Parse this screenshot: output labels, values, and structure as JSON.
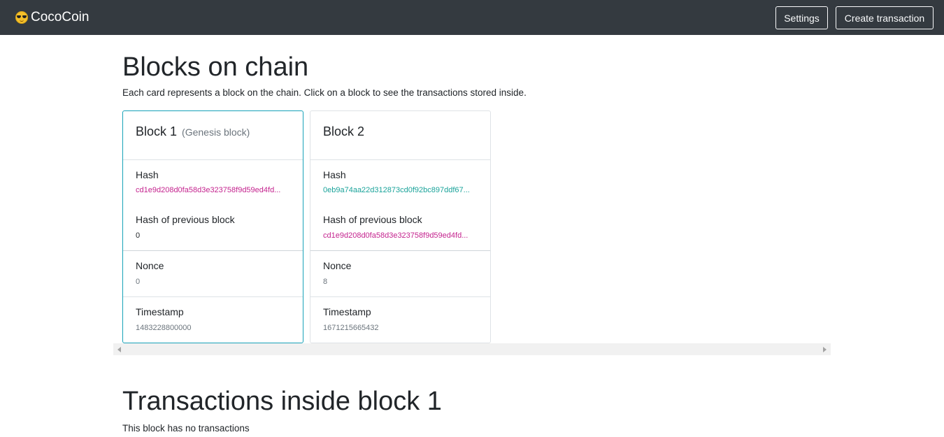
{
  "navbar": {
    "brand": "CocoCoin",
    "brand_icon": "sunglasses-face-icon",
    "settings_label": "Settings",
    "create_transaction_label": "Create transaction"
  },
  "blocks_section": {
    "title": "Blocks on chain",
    "description": "Each card represents a block on the chain. Click on a block to see the transactions stored inside."
  },
  "blocks": [
    {
      "title": "Block 1",
      "subtitle": "(Genesis block)",
      "hash_label": "Hash",
      "hash": "cd1e9d208d0fa58d3e323758f9d59ed4fd...",
      "prev_hash_label": "Hash of previous block",
      "prev_hash": "0",
      "nonce_label": "Nonce",
      "nonce": "0",
      "timestamp_label": "Timestamp",
      "timestamp": "1483228800000"
    },
    {
      "title": "Block 2",
      "subtitle": "",
      "hash_label": "Hash",
      "hash": "0eb9a74aa22d312873cd0f92bc897ddf67...",
      "prev_hash_label": "Hash of previous block",
      "prev_hash": "cd1e9d208d0fa58d3e323758f9d59ed4fd...",
      "nonce_label": "Nonce",
      "nonce": "8",
      "timestamp_label": "Timestamp",
      "timestamp": "1671215665432"
    }
  ],
  "transactions_section": {
    "title": "Transactions inside block 1",
    "empty_text": "This block has no transactions"
  },
  "colors": {
    "navbar_bg": "#343a40",
    "selected_border": "#17a2b8",
    "hash_pink": "#c4238e",
    "hash_teal": "#1aa39a"
  }
}
